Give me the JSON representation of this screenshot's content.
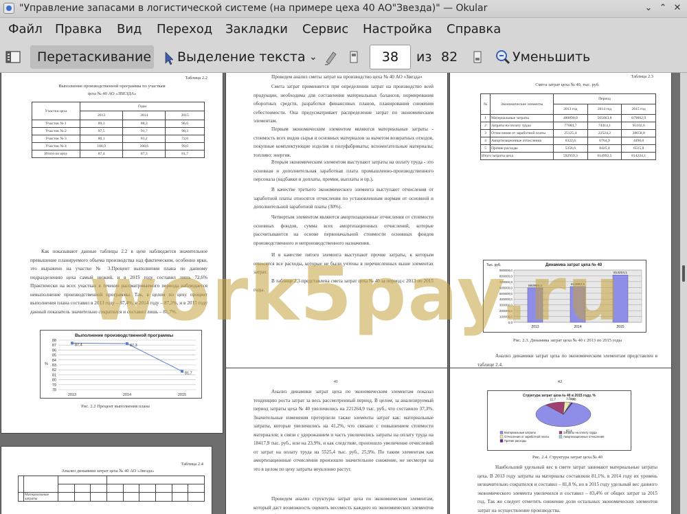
{
  "window": {
    "title": "\"Управление запасами в логистической системе (на примере цеха 40 АО\"Звезда)\"  — Okular"
  },
  "menu": [
    "Файл",
    "Правка",
    "Вид",
    "Переход",
    "Закладки",
    "Сервис",
    "Настройка",
    "Справка"
  ],
  "toolbar": {
    "drag_label": "Перетаскивание",
    "select_label": "Выделение текста",
    "page_current": "38",
    "page_of": "из",
    "page_total": "82",
    "zoom_out_label": "Уменьшить"
  },
  "watermark": "work5pay.ru",
  "page_left": {
    "table_caption": "Таблица 2.2",
    "table_title_1": "Выполнение производственной программы по участкам",
    "table_title_2": "цеха № 40 АО «ЗВЕЗДА»",
    "table_header_col1": "Участки цеха",
    "table_header_group": "Годы",
    "years": [
      "2013",
      "2014",
      "2015"
    ],
    "rows": [
      [
        "Участок № 1",
        "89,3",
        "88,3",
        "96,6"
      ],
      [
        "Участок № 2",
        "97,5",
        "91,7",
        "98,3"
      ],
      [
        "Участок № 3",
        "80,1",
        "83,2",
        "72,6"
      ],
      [
        "Участок № 4",
        "100,9",
        "100,6",
        "99,0"
      ],
      [
        "Итого по цеху",
        "87,4",
        "87,3",
        "81,7"
      ]
    ],
    "paragraph": "Как показывают данные таблицы 2.2 в цехе наблюдается значительное превышение планируемого объема производства над фактическим, особенно ярко, это выражено на участке № 3.Процент выполнения плана по данному подразделению цеха самый низкий, и в 2015 году составил лишь 72,6% Практически на всех участках в течение рассматриваемого периода наблюдается невыполнение производственной программы. Так, в целом по цеху процент выполнения плана составил в 2013 году – 87,4%, в 2014 году – 87,3%, и в 2015 году данный показатель значительно сократился и составил лишь – 81,7%.",
    "chart_caption": "Рис. 2.2 Процент выполнения плана"
  },
  "page_middle": {
    "paragraphs": [
      "Проведем анализ сметы затрат на производство цеха № 40 АО «Звезда»",
      "Смета затрат применяется при определении затрат на производство всей продукции, необходима для составления материальных балансов, нормирования оборотных средств, разработки финансовых планов, планирования снижения себестоимости. Она предусматривает распределение затрат по экономическим элементам.",
      "Первым экономическим элементом являются материальные затраты - стоимость всех видов сырья и основных материалов за вычетом возвратных отходов, покупные комплектующие изделия и полуфабрикаты; вспомогательные материалы; топливо; энергия.",
      "Вторым экономическим элементом выступают затраты на оплату труда - это основная и дополнительная заработная плата промышленно-производственного персонала (надбавки и доплаты, премии, выплаты и пр.).",
      "В качестве третьего экономического элемента выступают отчисления от заработной платы относятся отчисления по установленным нормам от основной и дополнительной заработной платы (30%).",
      "Четвертым элементом являются амортизационные отчисления от стоимости основных фондов, сумма всех амортизационных отчислений, которые рассчитываются на основе первоначальной стоимости основных фондов производственного и непроизводственного назначения.",
      "И в качестве пятого элемента выступают прочие затраты, к которым относятся все расходы, которые не были учтены в перечисленных выше элементах затрат.",
      "В таблице 2.3 представлена смета затрат цеха № 40 за период с 2013 по 2015 годы."
    ]
  },
  "page_right": {
    "table_caption": "Таблица 2.3",
    "table_title": "Смета затрат цеха № 40, тыс. руб.",
    "col_num": "№",
    "col_elem": "Экономические элементы",
    "col_period": "Период",
    "years": [
      "2013 год",
      "2014 год",
      "2015 год"
    ],
    "rows": [
      [
        "1",
        "Материальные затраты",
        "480890,0",
        "505063,8",
        "679062,9"
      ],
      [
        "2",
        "Затраты на оплату труда",
        "77084,7",
        "74414,1",
        "95102,6"
      ],
      [
        "3",
        "Отчисления от заработной платы",
        "25125,4",
        "22524,2",
        "28658,8"
      ],
      [
        "4",
        "Амортизационные отчисления",
        "6322,6",
        "6764,9",
        "4496,0"
      ],
      [
        "5",
        "Прочие расходы",
        "5356,6",
        "8425,4",
        "6515,8"
      ]
    ],
    "total_label": "Итого затраты цеха",
    "total": [
      "592959,3",
      "614992,5",
      "814224,1"
    ],
    "chart_caption": "Рис. 2.3. Динамика затрат цеха № 40 с 2013 по 2015 годы",
    "paragraph": "Анализ динамики затрат цеха по экономическим элементам представлен в таблице 2.4."
  },
  "page_bottom_left": {
    "table_caption": "Таблица 2.4",
    "table_title": "Анализ динамики затрат цеха № 40 АО «Звезда»",
    "row1_label": "Материальные затраты"
  },
  "page_bottom_middle": {
    "page_number": "41",
    "paragraph_1": "Анализ динамики затрат цеха по экономическим элементам показал тенденцию роста затрат за весь рассмотренный период. В целом, за анализируемый период затраты цеха № 40 увеличились на 221264,9 тыс. руб., что составило 37,3%. Значительные изменения претерпели также элементы затрат как: материальные затраты, которые увеличились на 41,2%, что связано с повышением стоимости материалов; в связи с удорожанием и часть увеличились затраты на оплату труда на 18417,9 тыс. руб., или на 23,9%, и как следствие, произошло увеличение отчислений от затрат на оплату труда на 5525,4 тыс. руб., 25,9%. По таким элементам как амортизационные отчисления произошло значительное снижение, не несмотря на это в целом по цеху затраты неуклонно растут.",
    "paragraph_2": "Проведем анализ структуры затрат цеха по экономическим элементам, который даст возможность оценить весомость каждого из экономических элементов затрат в общей сумме затрат цеха."
  },
  "page_bottom_right": {
    "page_number": "42",
    "chart_caption": "Рис. 2.4. Структура затрат цеха № 40",
    "paragraph": "Наибольший удельный вес в смете затрат занимают материальные затраты цеха. В 2013 году затраты на материалы составляли 81,1%, в 2014 году их уровень незначительно сократился и составил – 81,8 %, но в 2015 году удельный вес данного экономического элемента увеличился и составил – 83,4% от общих затрат за 2015 год. Так же следует отметить снижение доли остальных экономических элементов затрат на осуществление производства."
  },
  "chart_data": [
    {
      "type": "line",
      "title": "Выполнение производственной программы",
      "categories": [
        "2013",
        "2014",
        "2015"
      ],
      "series": [
        {
          "values": [
            87.4,
            87.3,
            81.7
          ]
        }
      ],
      "ylabel": "%",
      "ylim": [
        78,
        88
      ],
      "yticks": [
        "88",
        "87",
        "86",
        "85",
        "84",
        "83",
        "82",
        "81",
        "80",
        "79",
        "78"
      ],
      "data_labels": [
        "87,4",
        "87,3",
        "81,7"
      ],
      "grid": true,
      "line_color": "#5b7fd1"
    },
    {
      "type": "bar",
      "title": "Динамика затрат цеха № 40",
      "categories": [
        "2013",
        "2014",
        "2015"
      ],
      "values": [
        592959.3,
        614992.5,
        814224.1
      ],
      "data_labels": [
        "592959,3",
        "614992,5",
        "814224,1"
      ],
      "ylabel": "Тыс. руб.",
      "ylim": [
        0,
        900000
      ],
      "yticks": [
        "900000,0",
        "800000,0",
        "700000,0",
        "600000,0",
        "500000,0",
        "400000,0",
        "300000,0",
        "200000,0",
        "100000,0",
        "0,0"
      ],
      "bar_color": "#8e8ee8"
    },
    {
      "type": "pie",
      "title": "Структура затрат цеха № 40 в 2015 году, %",
      "labels": [
        "Материальные затраты",
        "Затраты на оплату труда",
        "Отчисления от заработной платы",
        "Амортизационные отчисления",
        "Прочие расходы"
      ],
      "values": [
        83.4,
        11.7,
        3.5,
        0.6,
        0.8
      ],
      "data_labels": [
        "83,4",
        "11,7",
        "3,5",
        "0,6",
        "0,8"
      ],
      "colors": [
        "#8e8ee8",
        "#a04070",
        "#e8e8b0",
        "#9fd0e0",
        "#6a2a80"
      ]
    }
  ]
}
